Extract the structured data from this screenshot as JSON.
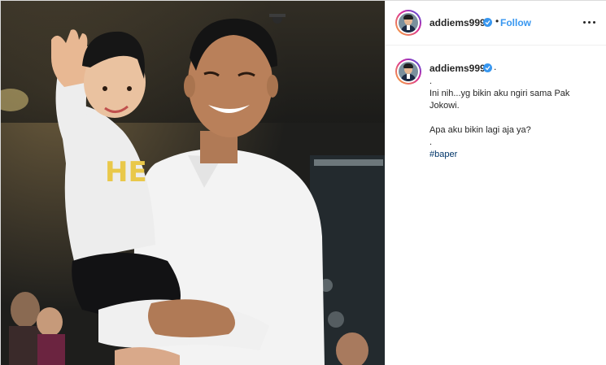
{
  "post": {
    "username": "addiems999",
    "follow_label": "Follow",
    "separator": "•",
    "more_icon": "more-options-icon"
  },
  "caption": {
    "username": "addiems999",
    "trailing": ".",
    "lines": [
      ".",
      "Ini nih...yg bikin aku ngiri sama Pak",
      "Jokowi.",
      "",
      "Apa aku bikin lagi aja ya?",
      "."
    ],
    "hashtag": "#baper"
  },
  "colors": {
    "link_blue": "#3897f0",
    "hashtag_blue": "#003569",
    "border": "#dbdbdb"
  }
}
